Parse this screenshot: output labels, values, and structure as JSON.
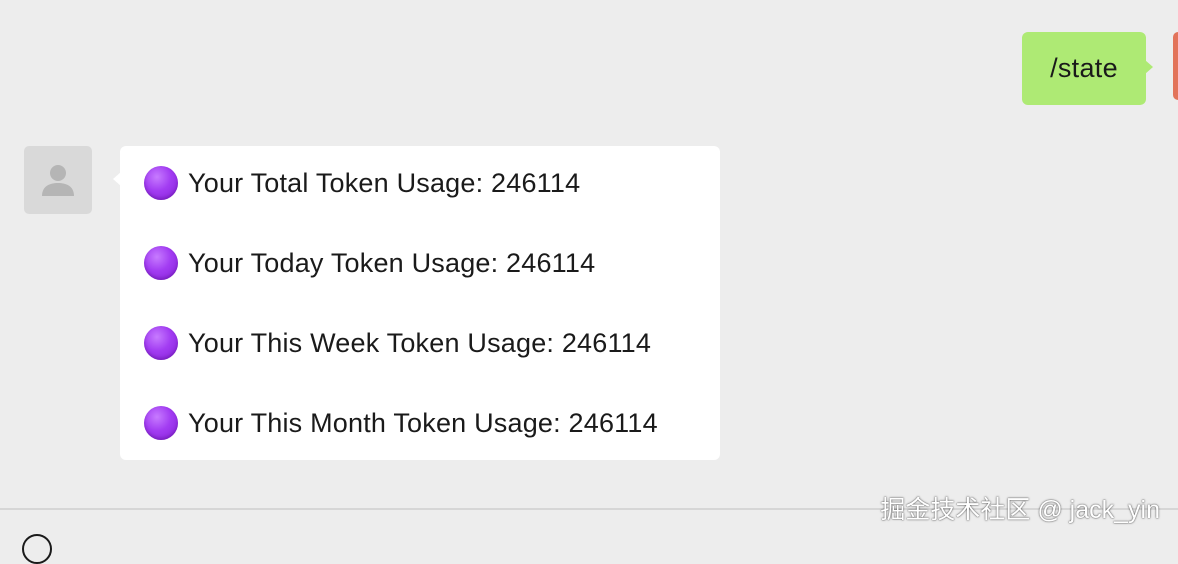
{
  "outgoing": {
    "text": "/state",
    "bubble_color": "#aeea74"
  },
  "incoming": {
    "bubble_color": "#ffffff",
    "avatar_icon": "default-user-icon",
    "bullet_icon": "purple-circle-icon",
    "bullet_color": "#a23cf2",
    "lines": [
      {
        "text": "Your Total Token Usage: 246114"
      },
      {
        "text": "Your Today Token Usage: 246114"
      },
      {
        "text": "Your This Week Token Usage: 246114"
      },
      {
        "text": "Your This Month Token Usage: 246114"
      }
    ]
  },
  "self_avatar_color": "#e2735a",
  "watermark": "掘金技术社区 @ jack_yin"
}
